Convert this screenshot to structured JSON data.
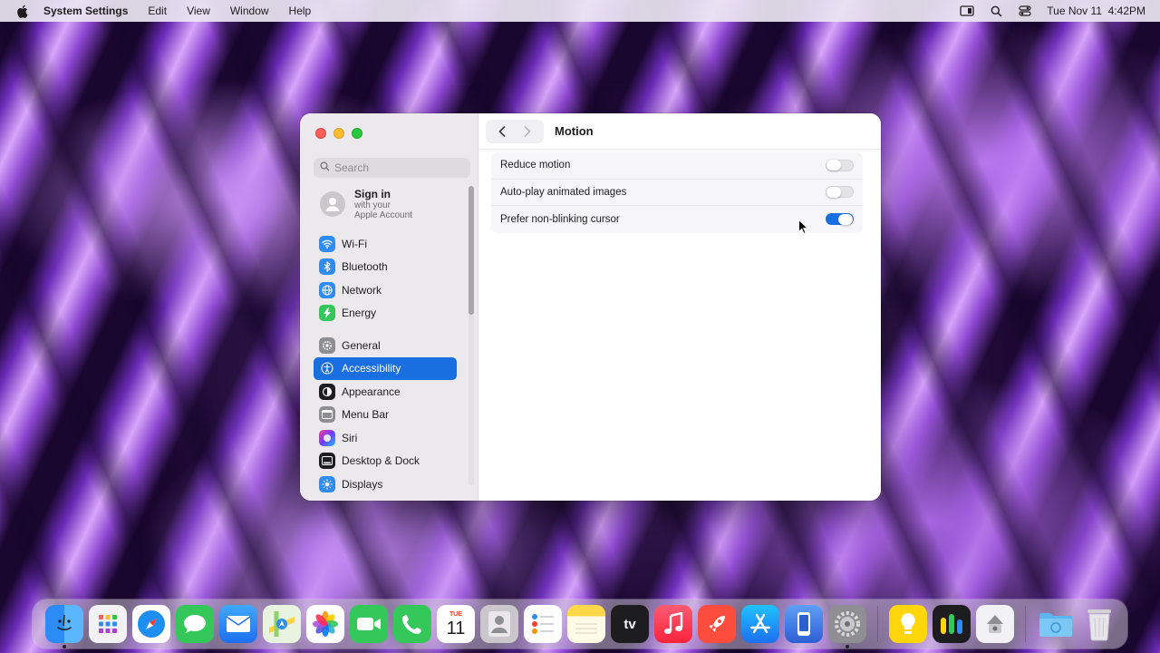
{
  "menubar": {
    "app_name": "System Settings",
    "menus": [
      "Edit",
      "View",
      "Window",
      "Help"
    ],
    "clock": "Tue Nov 11  4:42PM"
  },
  "sidebar": {
    "search_placeholder": "Search",
    "account": {
      "title": "Sign in",
      "subtitle_line1": "with your",
      "subtitle_line2": "Apple Account"
    },
    "group1": [
      {
        "label": "Wi-Fi",
        "icon": "wifi-icon",
        "color": "#2f8cf5"
      },
      {
        "label": "Bluetooth",
        "icon": "bluetooth-icon",
        "color": "#2f8cf5"
      },
      {
        "label": "Network",
        "icon": "globe-icon",
        "color": "#2f8cf5"
      },
      {
        "label": "Energy",
        "icon": "bolt-icon",
        "color": "#34c759"
      }
    ],
    "group2": [
      {
        "label": "General",
        "icon": "gear-icon",
        "color": "#8e8e93"
      },
      {
        "label": "Accessibility",
        "icon": "accessibility-icon",
        "color": "#1a6fe0",
        "active": true
      },
      {
        "label": "Appearance",
        "icon": "appearance-icon",
        "color": "#1d1d1f"
      },
      {
        "label": "Menu Bar",
        "icon": "menubar-icon",
        "color": "#8e8e93"
      },
      {
        "label": "Siri",
        "icon": "siri-icon",
        "color": "#b03ad8"
      },
      {
        "label": "Desktop & Dock",
        "icon": "dock-icon",
        "color": "#1d1d1f"
      },
      {
        "label": "Displays",
        "icon": "sun-icon",
        "color": "#2f8cf5"
      }
    ]
  },
  "pane": {
    "title": "Motion",
    "settings": [
      {
        "label": "Reduce motion",
        "on": false
      },
      {
        "label": "Auto-play animated images",
        "on": false
      },
      {
        "label": "Prefer non-blinking cursor",
        "on": true
      }
    ],
    "help_label": "?"
  },
  "dock": {
    "calendar_month": "TUE",
    "calendar_day": "11",
    "tv_label": "tv"
  },
  "colors": {
    "accent": "#1a6fe0",
    "sidebar_bg": "#ebe9ec"
  }
}
